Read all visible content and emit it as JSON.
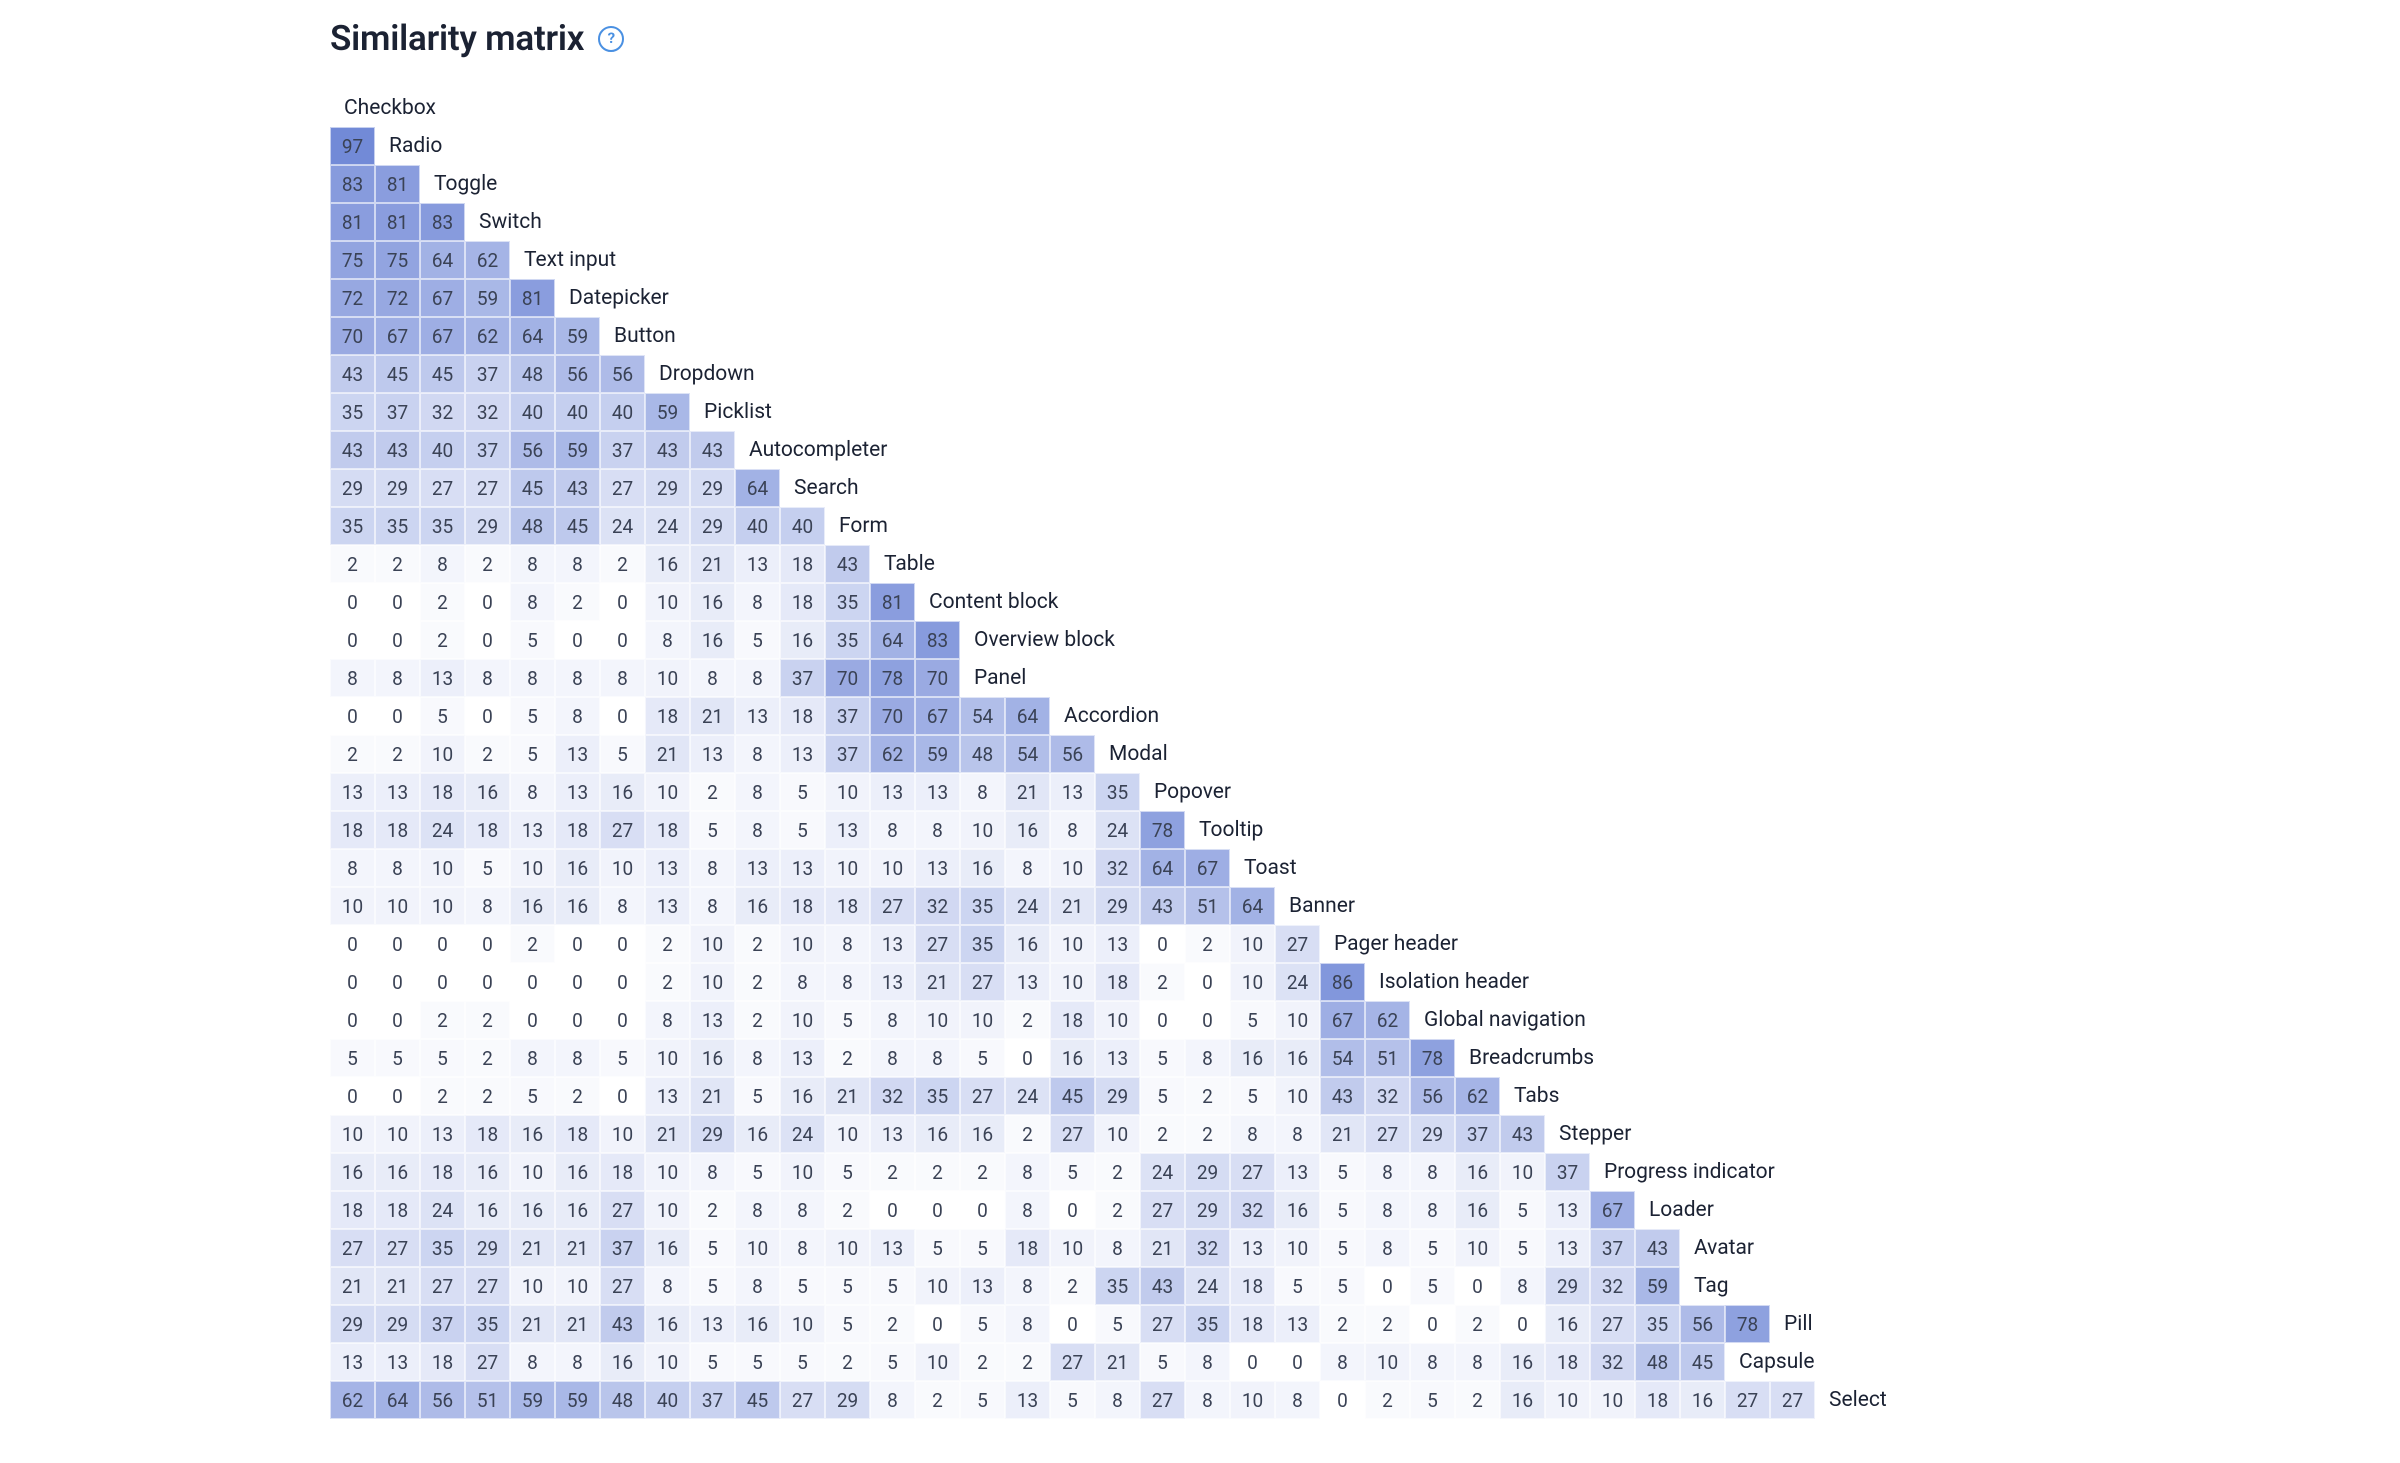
{
  "title": "Similarity matrix",
  "help_glyph": "?",
  "chart_data": {
    "type": "heatmap",
    "title": "Similarity matrix",
    "value_range": [
      0,
      100
    ],
    "color_scale": {
      "low": "#ffffff",
      "high": "#6e86d6",
      "text_near_high": "#3a4255"
    },
    "labels": [
      "Checkbox",
      "Radio",
      "Toggle",
      "Switch",
      "Text input",
      "Datepicker",
      "Button",
      "Dropdown",
      "Picklist",
      "Autocompleter",
      "Search",
      "Form",
      "Table",
      "Content block",
      "Overview block",
      "Panel",
      "Accordion",
      "Modal",
      "Popover",
      "Tooltip",
      "Toast",
      "Banner",
      "Pager header",
      "Isolation header",
      "Global navigation",
      "Breadcrumbs",
      "Tabs",
      "Stepper",
      "Progress indicator",
      "Loader",
      "Avatar",
      "Tag",
      "Pill",
      "Capsule",
      "Select"
    ],
    "rows": [
      [
        97
      ],
      [
        83,
        81
      ],
      [
        81,
        81,
        83
      ],
      [
        75,
        75,
        64,
        62
      ],
      [
        72,
        72,
        67,
        59,
        81
      ],
      [
        70,
        67,
        67,
        62,
        64,
        59
      ],
      [
        43,
        45,
        45,
        37,
        48,
        56,
        56
      ],
      [
        35,
        37,
        32,
        32,
        40,
        40,
        40,
        59
      ],
      [
        43,
        43,
        40,
        37,
        56,
        59,
        37,
        43,
        43
      ],
      [
        29,
        29,
        27,
        27,
        45,
        43,
        27,
        29,
        29,
        64
      ],
      [
        35,
        35,
        35,
        29,
        48,
        45,
        24,
        24,
        29,
        40,
        40
      ],
      [
        2,
        2,
        8,
        2,
        8,
        8,
        2,
        16,
        21,
        13,
        18,
        43
      ],
      [
        0,
        0,
        2,
        0,
        8,
        2,
        0,
        10,
        16,
        8,
        18,
        35,
        81
      ],
      [
        0,
        0,
        2,
        0,
        5,
        0,
        0,
        8,
        16,
        5,
        16,
        35,
        64,
        83
      ],
      [
        8,
        8,
        13,
        8,
        8,
        8,
        8,
        10,
        8,
        8,
        37,
        70,
        78,
        70
      ],
      [
        0,
        0,
        5,
        0,
        5,
        8,
        0,
        18,
        21,
        13,
        18,
        37,
        70,
        67,
        54,
        64
      ],
      [
        2,
        2,
        10,
        2,
        5,
        13,
        5,
        21,
        13,
        8,
        13,
        37,
        62,
        59,
        48,
        54,
        56
      ],
      [
        13,
        13,
        18,
        16,
        8,
        13,
        16,
        10,
        2,
        8,
        5,
        10,
        13,
        13,
        8,
        21,
        13,
        35
      ],
      [
        18,
        18,
        24,
        18,
        13,
        18,
        27,
        18,
        5,
        8,
        5,
        13,
        8,
        8,
        10,
        16,
        8,
        24,
        78
      ],
      [
        8,
        8,
        10,
        5,
        10,
        16,
        10,
        13,
        8,
        13,
        13,
        10,
        10,
        13,
        16,
        8,
        10,
        32,
        64,
        67
      ],
      [
        10,
        10,
        10,
        8,
        16,
        16,
        8,
        13,
        8,
        16,
        18,
        18,
        27,
        32,
        35,
        24,
        21,
        29,
        43,
        51,
        64
      ],
      [
        0,
        0,
        0,
        0,
        2,
        0,
        0,
        2,
        10,
        2,
        10,
        8,
        13,
        27,
        35,
        16,
        10,
        13,
        0,
        2,
        10,
        27
      ],
      [
        0,
        0,
        0,
        0,
        0,
        0,
        0,
        2,
        10,
        2,
        8,
        8,
        13,
        21,
        27,
        13,
        10,
        18,
        2,
        0,
        10,
        24,
        86
      ],
      [
        0,
        0,
        2,
        2,
        0,
        0,
        0,
        8,
        13,
        2,
        10,
        5,
        8,
        10,
        10,
        2,
        18,
        10,
        0,
        0,
        5,
        10,
        67,
        62
      ],
      [
        5,
        5,
        5,
        2,
        8,
        8,
        5,
        10,
        16,
        8,
        13,
        2,
        8,
        8,
        5,
        0,
        16,
        13,
        5,
        8,
        16,
        16,
        54,
        51,
        78
      ],
      [
        0,
        0,
        2,
        2,
        5,
        2,
        0,
        13,
        21,
        5,
        16,
        21,
        32,
        35,
        27,
        24,
        45,
        29,
        5,
        2,
        5,
        10,
        43,
        32,
        56,
        62
      ],
      [
        10,
        10,
        13,
        18,
        16,
        18,
        10,
        21,
        29,
        16,
        24,
        10,
        13,
        16,
        16,
        2,
        27,
        10,
        2,
        2,
        8,
        8,
        21,
        27,
        29,
        37,
        43
      ],
      [
        16,
        16,
        18,
        16,
        10,
        16,
        18,
        10,
        8,
        5,
        10,
        5,
        2,
        2,
        2,
        8,
        5,
        2,
        24,
        29,
        27,
        13,
        5,
        8,
        8,
        16,
        10,
        37
      ],
      [
        18,
        18,
        24,
        16,
        16,
        16,
        27,
        10,
        2,
        8,
        8,
        2,
        0,
        0,
        0,
        8,
        0,
        2,
        27,
        29,
        32,
        16,
        5,
        8,
        8,
        16,
        5,
        13,
        67
      ],
      [
        27,
        27,
        35,
        29,
        21,
        21,
        37,
        16,
        5,
        10,
        8,
        10,
        13,
        5,
        5,
        18,
        10,
        8,
        21,
        32,
        13,
        10,
        5,
        8,
        5,
        10,
        5,
        13,
        37,
        43
      ],
      [
        21,
        21,
        27,
        27,
        10,
        10,
        27,
        8,
        5,
        8,
        5,
        5,
        5,
        10,
        13,
        8,
        2,
        35,
        43,
        24,
        18,
        5,
        5,
        0,
        5,
        0,
        8,
        29,
        32,
        59
      ],
      [
        29,
        29,
        37,
        35,
        21,
        21,
        43,
        16,
        13,
        16,
        10,
        5,
        2,
        0,
        5,
        8,
        0,
        5,
        27,
        35,
        18,
        13,
        2,
        2,
        0,
        2,
        0,
        16,
        27,
        35,
        56,
        78
      ],
      [
        13,
        13,
        18,
        27,
        8,
        8,
        16,
        10,
        5,
        5,
        5,
        2,
        5,
        10,
        2,
        2,
        27,
        21,
        5,
        8,
        0,
        0,
        8,
        10,
        8,
        8,
        16,
        18,
        32,
        48,
        45
      ],
      [
        62,
        64,
        56,
        51,
        59,
        59,
        48,
        40,
        37,
        45,
        27,
        29,
        8,
        2,
        5,
        13,
        5,
        8,
        27,
        8,
        10,
        8,
        0,
        2,
        5,
        2,
        16,
        10,
        10,
        18,
        16,
        27,
        27
      ]
    ]
  }
}
